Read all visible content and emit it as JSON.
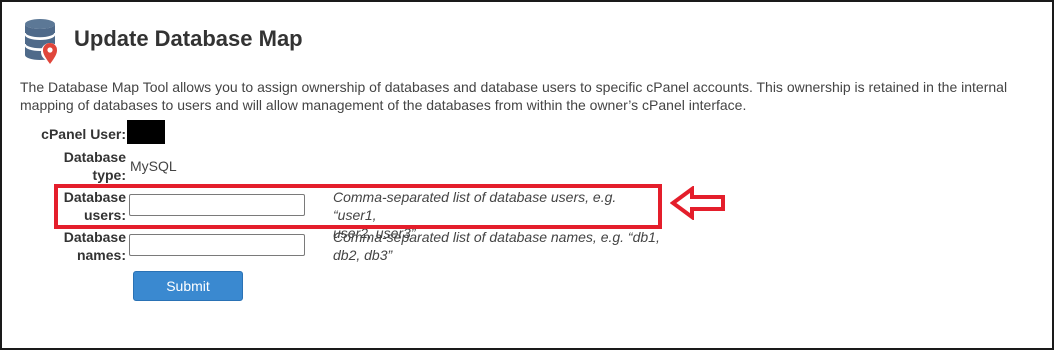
{
  "page": {
    "title": "Update Database Map",
    "description": "The Database Map Tool allows you to assign ownership of databases and database users to specific cPanel accounts. This ownership is retained in the internal mapping of databases to users and will allow management of the databases from within the owner’s cPanel interface."
  },
  "form": {
    "cpanel_user_label": "cPanel User:",
    "database_type_label_line1": "Database",
    "database_type_label_line2": "type:",
    "database_type_value": "MySQL",
    "database_users_label_line1": "Database",
    "database_users_label_line2": "users:",
    "database_users_value": "",
    "database_users_hint_line1": "Comma-separated list of database users, e.g. “user1,",
    "database_users_hint_line2": "user2, user3”",
    "database_names_label_line1": "Database",
    "database_names_label_line2": "names:",
    "database_names_value": "",
    "database_names_hint_line1": "Comma-separated list of database names, e.g. “db1,",
    "database_names_hint_line2": "db2, db3”",
    "submit_label": "Submit"
  },
  "annotation": {
    "highlight_color": "#e41e2b"
  },
  "colors": {
    "accent": "#3a89d0",
    "icon_db": "#4f6a8a",
    "pin": "#e0463b"
  }
}
